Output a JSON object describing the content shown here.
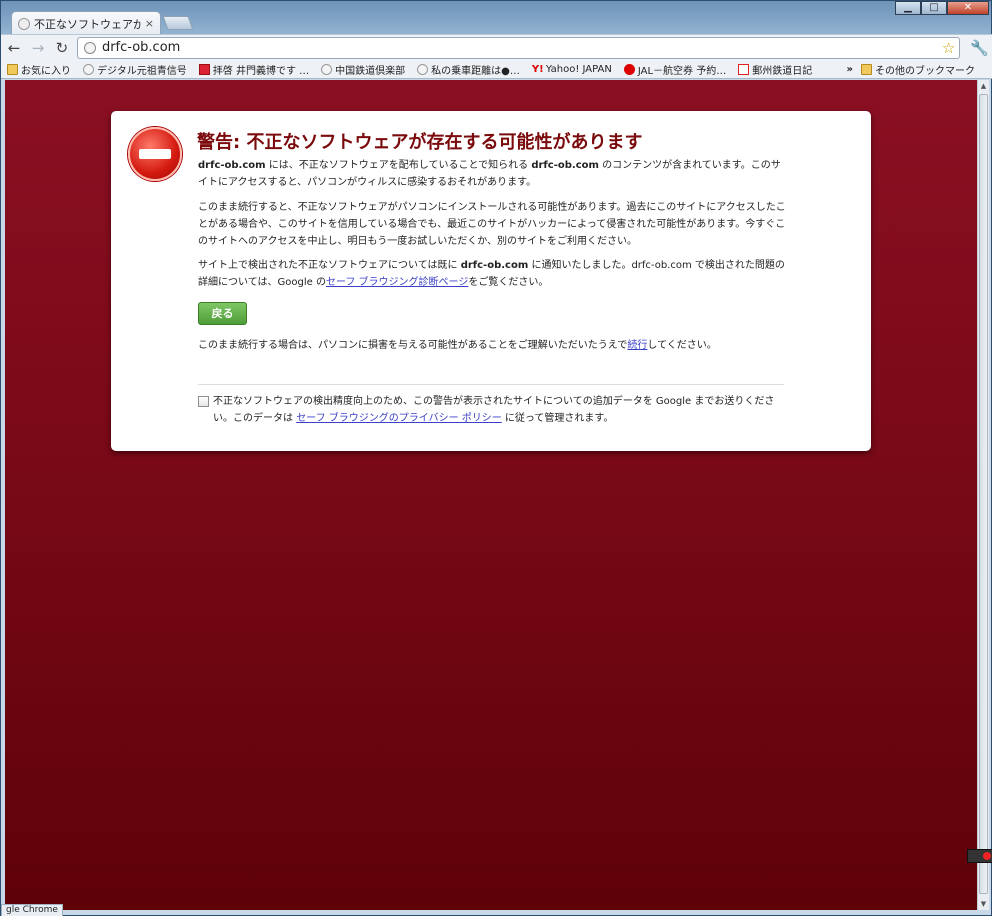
{
  "window": {
    "minimize_glyph": "▁",
    "maximize_glyph": "□",
    "close_glyph": "✕"
  },
  "tab": {
    "title": "不正なソフトウェアが検知",
    "close_glyph": "×"
  },
  "toolbar": {
    "back_glyph": "←",
    "forward_glyph": "→",
    "reload_glyph": "↻",
    "url": "drfc-ob.com",
    "star_glyph": "☆",
    "wrench_glyph": "🔧"
  },
  "bookmarks": {
    "items": [
      {
        "label": "お気に入り",
        "icon": "folder-icon"
      },
      {
        "label": "デジタル元祖青信号",
        "icon": "globe-icon"
      },
      {
        "label": "拝啓 井門義博です …",
        "icon": "red-square-icon"
      },
      {
        "label": "中国鉄道倶楽部",
        "icon": "globe-icon"
      },
      {
        "label": "私の乗車距離は●…",
        "icon": "globe-icon"
      },
      {
        "label": "Yahoo! JAPAN",
        "icon": "yahoo-icon"
      },
      {
        "label": "JAL－航空券 予約…",
        "icon": "jal-icon"
      },
      {
        "label": "郵州鉄道日記",
        "icon": "red-box-icon"
      }
    ],
    "more": "»",
    "other_folder": "その他のブックマーク"
  },
  "warning": {
    "heading": "警告: 不正なソフトウェアが存在する可能性があります",
    "p1_site": "drfc-ob.com",
    "p1_a": " には、不正なソフトウェアを配布していることで知られる ",
    "p1_site2": "drfc-ob.com",
    "p1_b": " のコンテンツが含まれています。このサイトにアクセスすると、パソコンがウィルスに感染するおそれがあります。",
    "p2": "このまま続行すると、不正なソフトウェアがパソコンにインストールされる可能性があります。過去にこのサイトにアクセスしたことがある場合や、このサイトを信用している場合でも、最近このサイトがハッカーによって侵害された可能性があります。今すぐこのサイトへのアクセスを中止し、明日もう一度お試しいただくか、別のサイトをご利用ください。",
    "p3_a": "サイト上で検出された不正なソフトウェアについては既に ",
    "p3_site": "drfc-ob.com",
    "p3_b": " に通知いたしました。drfc-ob.com で検出された問題の詳細については、Google の",
    "p3_link": "セーフ ブラウジング診断ページ",
    "p3_c": "をご覧ください。",
    "back_button": "戻る",
    "p4_a": "このまま続行する場合は、パソコンに損害を与える可能性があることをご理解いただいたうえで",
    "p4_link": "続行",
    "p4_b": "してください。",
    "report_a": "不正なソフトウェアの検出精度向上のため、この警告が表示されたサイトについての追加データを Google までお送りください。このデータは ",
    "report_link": "セーフ ブラウジングのプライバシー ポリシー",
    "report_b": " に従って管理されます。"
  },
  "statusbar": {
    "text": "gle Chrome"
  },
  "scrollbar": {
    "up_glyph": "▲",
    "down_glyph": "▼"
  },
  "colors": {
    "page_background": "#7c0a18",
    "heading": "#7a0a0c",
    "back_button": "#5aaa44",
    "link": "#3b40c8"
  }
}
